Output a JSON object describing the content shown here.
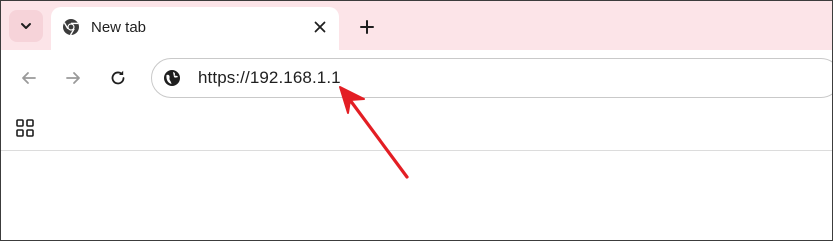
{
  "tab": {
    "title": "New tab",
    "favicon": "chrome-icon"
  },
  "tabstrip": {
    "search_icon": "chevron-down-icon",
    "close_icon": "close-icon",
    "new_tab_icon": "plus-icon"
  },
  "toolbar": {
    "back_icon": "arrow-left-icon",
    "forward_icon": "arrow-right-icon",
    "reload_icon": "reload-icon"
  },
  "omnibox": {
    "site_icon": "globe-icon",
    "url": "https://192.168.1.1"
  },
  "bookmarks": {
    "apps_icon": "apps-grid-icon"
  },
  "annotation": {
    "arrow_color": "#e31e24"
  },
  "colors": {
    "tabstrip_bg": "#fce4e8",
    "accent": "#e31e24"
  }
}
